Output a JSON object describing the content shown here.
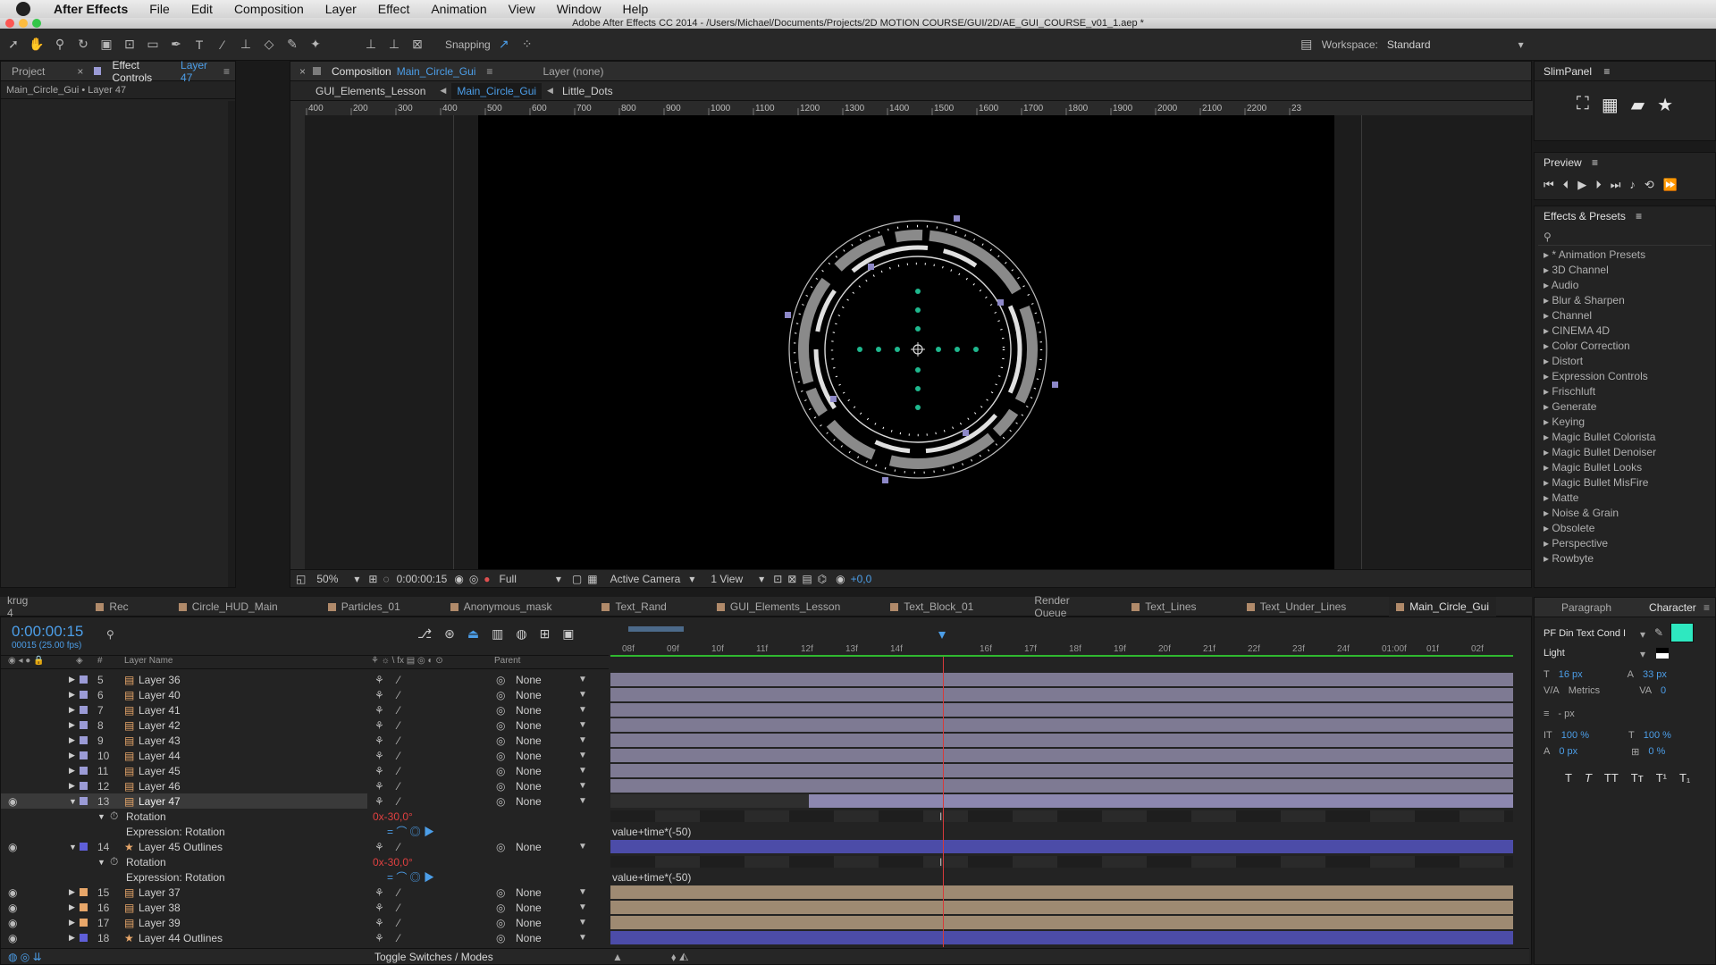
{
  "menubar": {
    "app": "After Effects",
    "items": [
      "File",
      "Edit",
      "Composition",
      "Layer",
      "Effect",
      "Animation",
      "View",
      "Window",
      "Help"
    ]
  },
  "window": {
    "title": "Adobe After Effects CC 2014 - /Users/Michael/Documents/Projects/2D MOTION COURSE/GUI/2D/AE_GUI_COURSE_v01_1.aep *"
  },
  "toolbar": {
    "snapping": "Snapping",
    "workspace_label": "Workspace:",
    "workspace_value": "Standard"
  },
  "left_panel": {
    "project_tab": "Project",
    "effect_controls_tab": "Effect Controls",
    "effect_controls_layer": "Layer 47",
    "breadcrumb": "Main_Circle_Gui • Layer 47"
  },
  "comp_panel": {
    "tab_prefix": "Composition",
    "tab_name": "Main_Circle_Gui",
    "layer_tab": "Layer (none)",
    "nav": [
      "GUI_Elements_Lesson",
      "Main_Circle_Gui",
      "Little_Dots"
    ],
    "ruler_labels": [
      "400",
      "200",
      "300",
      "400",
      "500",
      "600",
      "700",
      "800",
      "900",
      "1000",
      "1100",
      "1200",
      "1300",
      "1400",
      "1500",
      "1600",
      "1700",
      "1800",
      "1900",
      "2000",
      "2100",
      "2200",
      "23"
    ],
    "bottom": {
      "zoom": "50%",
      "timecode": "0:00:00:15",
      "resolution": "Full",
      "camera": "Active Camera",
      "views": "1 View",
      "exposure": "+0,0"
    }
  },
  "slim_panel": {
    "title": "SlimPanel"
  },
  "preview_panel": {
    "title": "Preview"
  },
  "effects_presets": {
    "title": "Effects & Presets",
    "items": [
      "* Animation Presets",
      "3D Channel",
      "Audio",
      "Blur & Sharpen",
      "Channel",
      "CINEMA 4D",
      "Color Correction",
      "Distort",
      "Expression Controls",
      "Frischluft",
      "Generate",
      "Keying",
      "Magic Bullet Colorista",
      "Magic Bullet Denoiser",
      "Magic Bullet Looks",
      "Magic Bullet MisFire",
      "Matte",
      "Noise & Grain",
      "Obsolete",
      "Perspective",
      "Rowbyte"
    ]
  },
  "timeline_tabs": [
    "krug 4",
    "Rec",
    "Circle_HUD_Main",
    "Particles_01",
    "Anonymous_mask",
    "Text_Rand",
    "GUI_Elements_Lesson",
    "Text_Block_01",
    "Render Queue",
    "Text_Lines",
    "Text_Under_Lines",
    "Main_Circle_Gui"
  ],
  "timeline": {
    "timecode": "0:00:00:15",
    "fps": "00015 (25.00 fps)",
    "col_hash": "#",
    "col_layer": "Layer Name",
    "col_parent": "Parent",
    "time_labels": [
      "08f",
      "09f",
      "10f",
      "11f",
      "12f",
      "13f",
      "14f",
      "",
      "16f",
      "17f",
      "18f",
      "19f",
      "20f",
      "21f",
      "22f",
      "23f",
      "24f",
      "01:00f",
      "01f",
      "02f"
    ],
    "toggle": "Toggle Switches / Modes",
    "layers": [
      {
        "num": "5",
        "name": "Layer 36",
        "parent": "None"
      },
      {
        "num": "6",
        "name": "Layer 40",
        "parent": "None"
      },
      {
        "num": "7",
        "name": "Layer 41",
        "parent": "None"
      },
      {
        "num": "8",
        "name": "Layer 42",
        "parent": "None"
      },
      {
        "num": "9",
        "name": "Layer 43",
        "parent": "None"
      },
      {
        "num": "10",
        "name": "Layer 44",
        "parent": "None"
      },
      {
        "num": "11",
        "name": "Layer 45",
        "parent": "None"
      },
      {
        "num": "12",
        "name": "Layer 46",
        "parent": "None"
      },
      {
        "num": "13",
        "name": "Layer 47",
        "parent": "None"
      },
      {
        "num": "14",
        "name": "Layer 45 Outlines",
        "parent": "None"
      },
      {
        "num": "15",
        "name": "Layer 37",
        "parent": "None"
      },
      {
        "num": "16",
        "name": "Layer 38",
        "parent": "None"
      },
      {
        "num": "17",
        "name": "Layer 39",
        "parent": "None"
      },
      {
        "num": "18",
        "name": "Layer 44 Outlines",
        "parent": "None"
      }
    ],
    "rotation_label": "Rotation",
    "rotation_value": "0x-30,0°",
    "expr_label": "Expression: Rotation",
    "expr_value": "value+time*(-50)"
  },
  "character_panel": {
    "paragraph_tab": "Paragraph",
    "character_tab": "Character",
    "font": "PF Din Text Cond I",
    "style": "Light",
    "size": "16 px",
    "leading": "33 px",
    "kerning": "Metrics",
    "tracking": "0",
    "stroke": "- px",
    "vscale": "100 %",
    "hscale": "100 %",
    "baseline": "0 px",
    "tsume": "0 %",
    "accent": "#2ee8c0"
  }
}
